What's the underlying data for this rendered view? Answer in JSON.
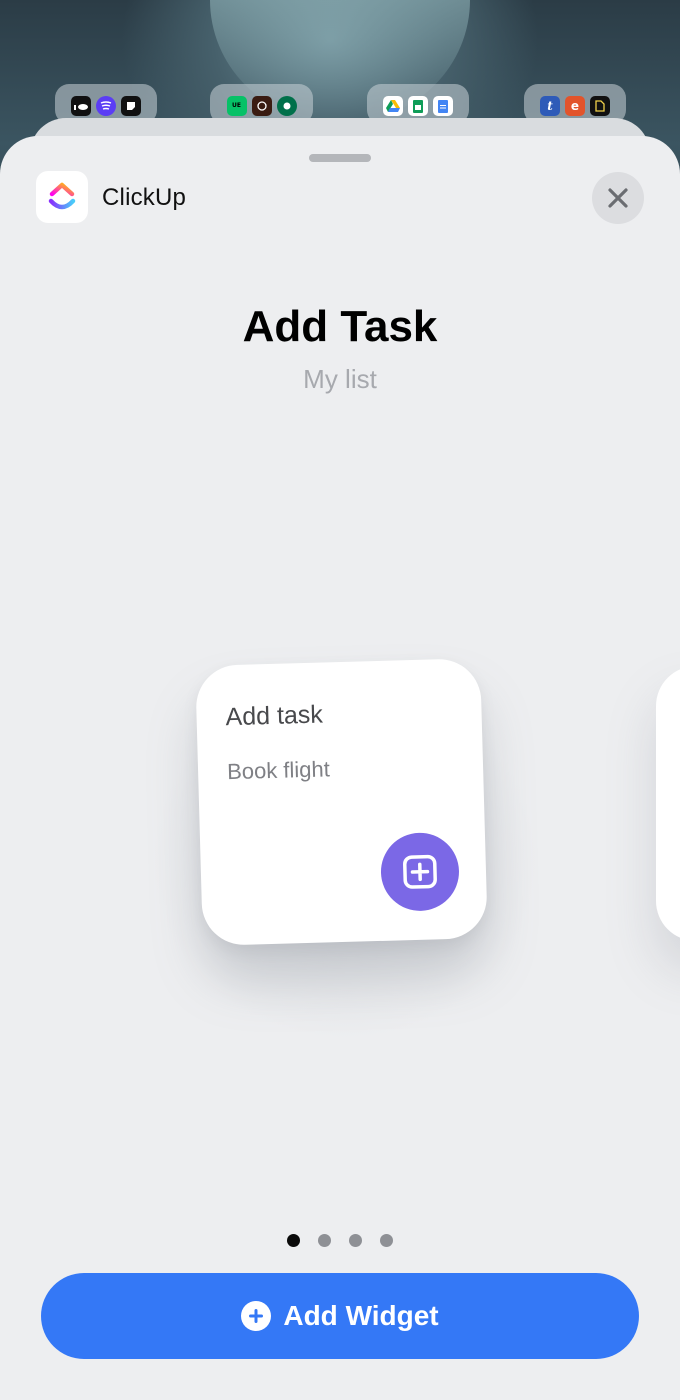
{
  "app": {
    "name": "ClickUp"
  },
  "widget_gallery": {
    "title": "Add Task",
    "subtitle": "My list"
  },
  "widget_preview": {
    "title": "Add task",
    "placeholder": "Book flight",
    "button_icon": "plus-square-icon"
  },
  "pagination": {
    "count": 4,
    "active_index": 0
  },
  "add_widget_button": {
    "label": "Add Widget",
    "icon": "plus-circle-icon"
  },
  "background_folders": [
    {
      "apps": [
        "soundcloud-icon",
        "spotify-icon",
        "notes-icon"
      ]
    },
    {
      "apps": [
        "uber-eats-icon",
        "coffee-icon",
        "starbucks-icon"
      ]
    },
    {
      "apps": [
        "google-drive-icon",
        "google-sheets-icon",
        "google-docs-icon"
      ]
    },
    {
      "apps": [
        "tumblr-icon",
        "e-icon",
        "file-icon"
      ]
    }
  ],
  "colors": {
    "accent_blue": "#3478f6",
    "widget_purple": "#7b68e6",
    "sheet_background": "#edeef0"
  }
}
